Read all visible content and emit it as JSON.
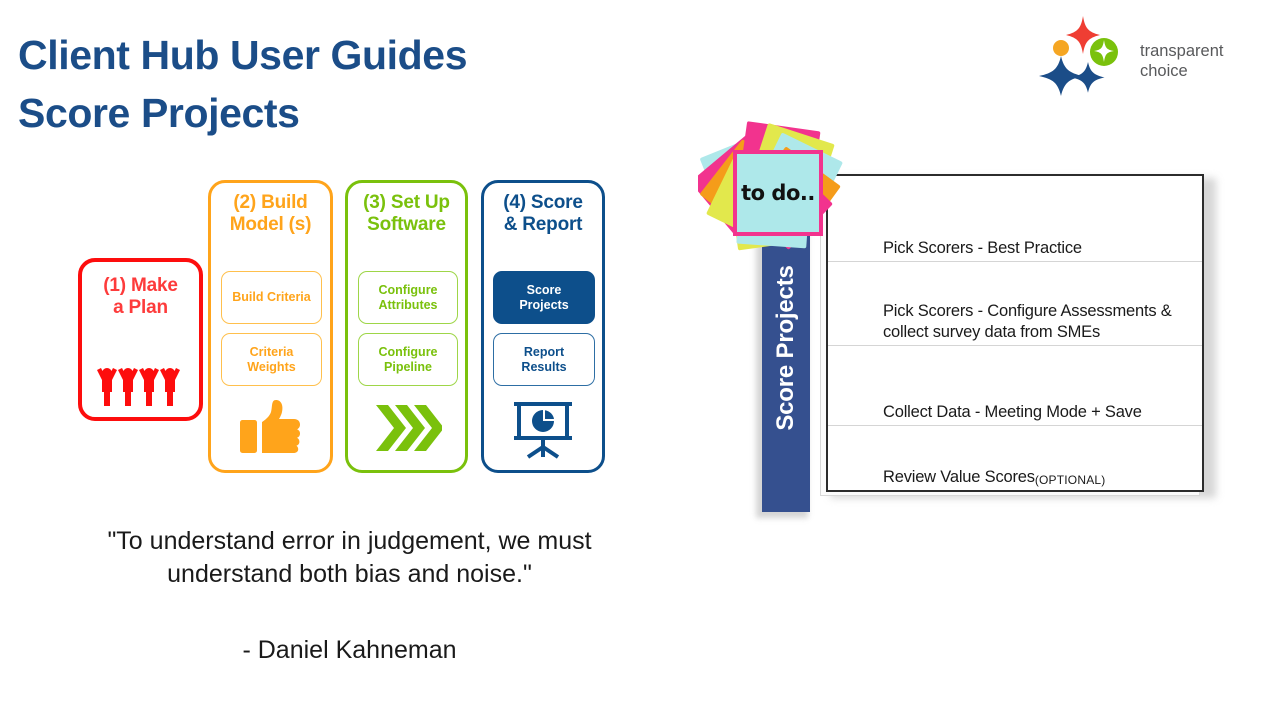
{
  "title": {
    "line1": "Client Hub User Guides",
    "line2": "Score Projects",
    "color": "#1b4d88"
  },
  "logo": {
    "name": "transparent-choice-logo",
    "line1": "transparent",
    "line2": "choice",
    "text_color": "#58595b",
    "colors": {
      "red_star": "#ef3e33",
      "orange_dot": "#f5a623",
      "green_circle": "#7ac10c",
      "blue_star": "#1b4d88"
    }
  },
  "process": {
    "cards": [
      {
        "id": "make-a-plan",
        "heading": "(1) Make\na Plan",
        "heading_line1": "(1) Make",
        "heading_line2": "a Plan",
        "color": "#fd0d0d",
        "text_color": "#fd3b3b",
        "icon": "people-group-icon",
        "sub_items": []
      },
      {
        "id": "build-models",
        "heading_line1": "(2) Build",
        "heading_line2": "Model (s)",
        "color": "#ffa41b",
        "text_color": "#ffa41b",
        "icon": "thumbs-up-icon",
        "sub_items": [
          {
            "label": "Build Criteria",
            "active": false
          },
          {
            "label": "Criteria\nWeights",
            "line1": "Criteria",
            "line2": "Weights",
            "active": false
          }
        ]
      },
      {
        "id": "set-up-software",
        "heading_line1": "(3) Set Up",
        "heading_line2": "Software",
        "color": "#7ac10c",
        "text_color": "#7ac10c",
        "icon": "double-chevron-right-icon",
        "sub_items": [
          {
            "line1": "Configure",
            "line2": "Attributes",
            "active": false
          },
          {
            "line1": "Configure",
            "line2": "Pipeline",
            "active": false
          }
        ]
      },
      {
        "id": "score-and-report",
        "heading_line1": "(4) Score",
        "heading_line2": "& Report",
        "color": "#0d4f8b",
        "text_color": "#0d4f8b",
        "icon": "presentation-pie-chart-icon",
        "sub_items": [
          {
            "line1": "Score",
            "line2": "Projects",
            "active": true
          },
          {
            "line1": "Report",
            "line2": "Results",
            "active": false
          }
        ]
      }
    ]
  },
  "quote": {
    "text": "\"To understand error in judgement, we must understand both bias and noise.\"",
    "author": "- Daniel Kahneman"
  },
  "todo_panel": {
    "sticky_note_label": "to do..",
    "tab_label": "Score Projects",
    "tab_color": "#35508f",
    "rows": [
      {
        "text": "Pick Scorers - Best Practice",
        "optional": ""
      },
      {
        "text": "Pick Scorers - Configure Assessments & collect survey data from SMEs",
        "optional": ""
      },
      {
        "text": "Collect Data - Meeting Mode + Save",
        "optional": ""
      },
      {
        "text": "Review Value Scores ",
        "optional": "(OPTIONAL)"
      }
    ]
  }
}
